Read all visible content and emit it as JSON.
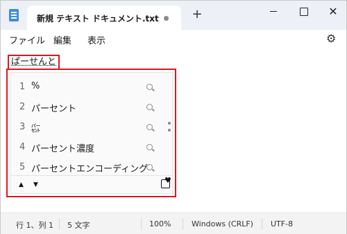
{
  "tab": {
    "title": "新規 テキスト ドキュメント.txt",
    "new_tab": "+"
  },
  "window_controls": {
    "close": "✕"
  },
  "menu": {
    "file": "ファイル",
    "edit": "編集",
    "view": "表示"
  },
  "editor": {
    "typed_text": "ぱーせんと"
  },
  "ime": {
    "candidates": [
      {
        "num": "1",
        "text": "%"
      },
      {
        "num": "2",
        "text": "パーセント"
      },
      {
        "num": "3",
        "text": "㌫"
      },
      {
        "num": "4",
        "text": "パーセント濃度"
      },
      {
        "num": "5",
        "text": "パーセントエンコーディング"
      }
    ],
    "prev": "▲",
    "next": "▼"
  },
  "status": {
    "position": "行 1、列 1",
    "chars": "5 文字",
    "zoom": "100%",
    "line_ending": "Windows (CRLF)",
    "encoding": "UTF-8"
  },
  "icons": [
    "notepad-icon",
    "settings-icon",
    "search-icon",
    "favorite-icon"
  ]
}
